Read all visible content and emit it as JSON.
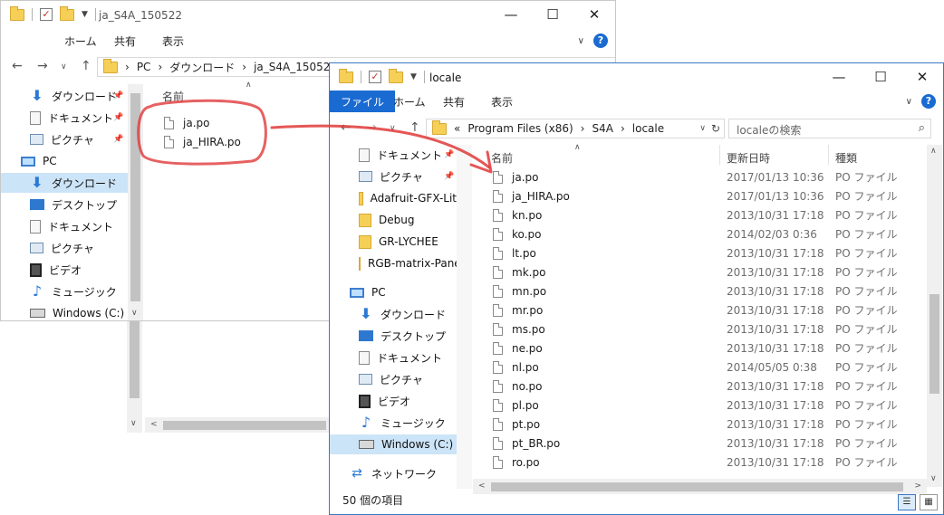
{
  "win1": {
    "title": "ja_S4A_150522",
    "ribbon_tabs": [
      "ホーム",
      "共有",
      "表示"
    ],
    "address": [
      "PC",
      "ダウンロード",
      "ja_S4A_150522"
    ],
    "nav": [
      {
        "label": "ダウンロード",
        "icon": "download-icon",
        "pinned": true
      },
      {
        "label": "ドキュメント",
        "icon": "document-icon",
        "pinned": true
      },
      {
        "label": "ピクチャ",
        "icon": "picture-icon",
        "pinned": true
      },
      {
        "label": "PC",
        "icon": "pc-icon",
        "pinned": false
      },
      {
        "label": "ダウンロード",
        "icon": "download-icon",
        "pinned": false,
        "selected": true
      },
      {
        "label": "デスクトップ",
        "icon": "desktop-icon",
        "pinned": false
      },
      {
        "label": "ドキュメント",
        "icon": "document-icon",
        "pinned": false
      },
      {
        "label": "ピクチャ",
        "icon": "picture-icon",
        "pinned": false
      },
      {
        "label": "ビデオ",
        "icon": "video-icon",
        "pinned": false
      },
      {
        "label": "ミュージック",
        "icon": "music-icon",
        "pinned": false
      },
      {
        "label": "Windows (C:)",
        "icon": "drive-icon",
        "pinned": false
      }
    ],
    "col_name": "名前",
    "files": [
      "ja.po",
      "ja_HIRA.po"
    ]
  },
  "win2": {
    "title": "locale",
    "ribbon_tabs": [
      "ファイル",
      "ホーム",
      "共有",
      "表示"
    ],
    "address_prefix": "«",
    "address": [
      "Program Files (x86)",
      "S4A",
      "locale"
    ],
    "search_placeholder": "localeの検索",
    "nav": [
      {
        "label": "ドキュメント",
        "icon": "document-icon",
        "pinned": true
      },
      {
        "label": "ピクチャ",
        "icon": "picture-icon",
        "pinned": true
      },
      {
        "label": "Adafruit-GFX-Lit",
        "icon": "folder-icon",
        "pinned": false
      },
      {
        "label": "Debug",
        "icon": "folder-icon",
        "pinned": false
      },
      {
        "label": "GR-LYCHEE",
        "icon": "folder-icon",
        "pinned": false
      },
      {
        "label": "RGB-matrix-Pane",
        "icon": "folder-icon",
        "pinned": false
      },
      {
        "label": "PC",
        "icon": "pc-icon",
        "pinned": false
      },
      {
        "label": "ダウンロード",
        "icon": "download-icon",
        "pinned": false
      },
      {
        "label": "デスクトップ",
        "icon": "desktop-icon",
        "pinned": false
      },
      {
        "label": "ドキュメント",
        "icon": "document-icon",
        "pinned": false
      },
      {
        "label": "ピクチャ",
        "icon": "picture-icon",
        "pinned": false
      },
      {
        "label": "ビデオ",
        "icon": "video-icon",
        "pinned": false
      },
      {
        "label": "ミュージック",
        "icon": "music-icon",
        "pinned": false
      },
      {
        "label": "Windows (C:)",
        "icon": "drive-icon",
        "pinned": false,
        "selected": true
      },
      {
        "label": "ネットワーク",
        "icon": "network-icon",
        "pinned": false
      }
    ],
    "columns": [
      "名前",
      "更新日時",
      "種類"
    ],
    "files": [
      {
        "name": "ja.po",
        "date": "2017/01/13 10:36",
        "type": "PO ファイル"
      },
      {
        "name": "ja_HIRA.po",
        "date": "2017/01/13 10:36",
        "type": "PO ファイル"
      },
      {
        "name": "kn.po",
        "date": "2013/10/31 17:18",
        "type": "PO ファイル"
      },
      {
        "name": "ko.po",
        "date": "2014/02/03 0:36",
        "type": "PO ファイル"
      },
      {
        "name": "lt.po",
        "date": "2013/10/31 17:18",
        "type": "PO ファイル"
      },
      {
        "name": "mk.po",
        "date": "2013/10/31 17:18",
        "type": "PO ファイル"
      },
      {
        "name": "mn.po",
        "date": "2013/10/31 17:18",
        "type": "PO ファイル"
      },
      {
        "name": "mr.po",
        "date": "2013/10/31 17:18",
        "type": "PO ファイル"
      },
      {
        "name": "ms.po",
        "date": "2013/10/31 17:18",
        "type": "PO ファイル"
      },
      {
        "name": "ne.po",
        "date": "2013/10/31 17:18",
        "type": "PO ファイル"
      },
      {
        "name": "nl.po",
        "date": "2014/05/05 0:38",
        "type": "PO ファイル"
      },
      {
        "name": "no.po",
        "date": "2013/10/31 17:18",
        "type": "PO ファイル"
      },
      {
        "name": "pl.po",
        "date": "2013/10/31 17:18",
        "type": "PO ファイル"
      },
      {
        "name": "pt.po",
        "date": "2013/10/31 17:18",
        "type": "PO ファイル"
      },
      {
        "name": "pt_BR.po",
        "date": "2013/10/31 17:18",
        "type": "PO ファイル"
      },
      {
        "name": "ro.po",
        "date": "2013/10/31 17:18",
        "type": "PO ファイル"
      }
    ],
    "status": "50 個の項目"
  },
  "colors": {
    "accent": "#1a6bd1",
    "selection": "#cce4f7",
    "annotation": "#e03a3a"
  }
}
